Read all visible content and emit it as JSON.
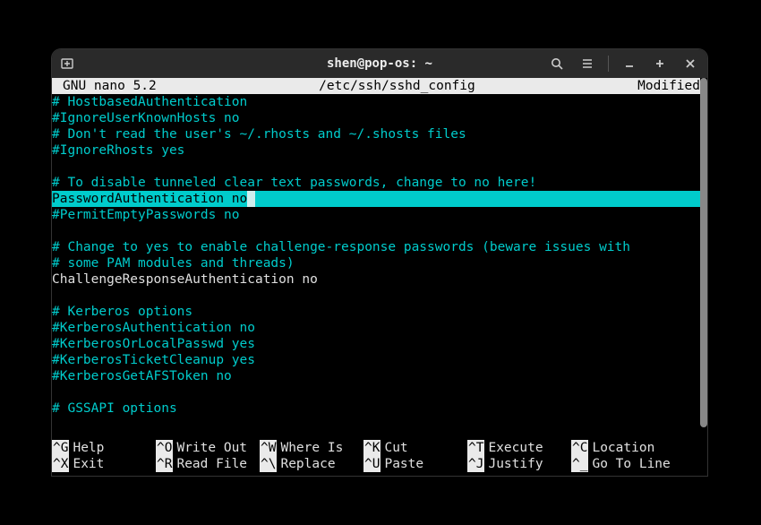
{
  "window": {
    "title": "shen@pop-os: ~"
  },
  "editor": {
    "app": "  GNU nano 5.2",
    "file": "/etc/ssh/sshd_config",
    "status": "Modified "
  },
  "lines": {
    "l0": "# HostbasedAuthentication",
    "l1": "#IgnoreUserKnownHosts no",
    "l2": "# Don't read the user's ~/.rhosts and ~/.shosts files",
    "l3": "#IgnoreRhosts yes",
    "l4": "",
    "l5": "# To disable tunneled clear text passwords, change to no here!",
    "l6": "PasswordAuthentication no",
    "l7": "#PermitEmptyPasswords no",
    "l8": "",
    "l9": "# Change to yes to enable challenge-response passwords (beware issues with",
    "l10": "# some PAM modules and threads)",
    "l11": "ChallengeResponseAuthentication no",
    "l12": "",
    "l13": "# Kerberos options",
    "l14": "#KerberosAuthentication no",
    "l15": "#KerberosOrLocalPasswd yes",
    "l16": "#KerberosTicketCleanup yes",
    "l17": "#KerberosGetAFSToken no",
    "l18": "",
    "l19": "# GSSAPI options"
  },
  "help": {
    "r0": {
      "k0": "^G",
      "t0": "Help",
      "k1": "^O",
      "t1": "Write Out",
      "k2": "^W",
      "t2": "Where Is",
      "k3": "^K",
      "t3": "Cut",
      "k4": "^T",
      "t4": "Execute",
      "k5": "^C",
      "t5": "Location"
    },
    "r1": {
      "k0": "^X",
      "t0": "Exit",
      "k1": "^R",
      "t1": "Read File",
      "k2": "^\\",
      "t2": "Replace",
      "k3": "^U",
      "t3": "Paste",
      "k4": "^J",
      "t4": "Justify",
      "k5": "^_",
      "t5": "Go To Line"
    }
  }
}
